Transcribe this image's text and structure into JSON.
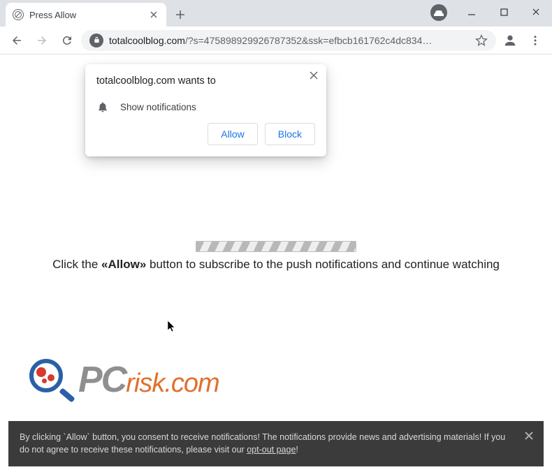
{
  "window": {
    "tab_title": "Press Allow",
    "minimize": "–",
    "maximize": "▢",
    "close": "✕"
  },
  "toolbar": {
    "url_domain": "totalcoolblog.com",
    "url_rest": "/?s=475898929926787352&ssk=efbcb161762c4dc834…"
  },
  "permission": {
    "title": "totalcoolblog.com wants to",
    "item": "Show notifications",
    "allow": "Allow",
    "block": "Block"
  },
  "page": {
    "msg_prefix": "Click the ",
    "msg_quote": "«Allow»",
    "msg_suffix": " button to subscribe to the push notifications and continue watching"
  },
  "logo": {
    "part1": "PC",
    "part2": "risk.com"
  },
  "consent": {
    "text1": "By clicking `Allow` button, you consent to receive notifications! The notifications provide news and advertising materials! If you do not agree to receive these notifications, please visit our ",
    "link": "opt-out page",
    "text2": "!"
  }
}
